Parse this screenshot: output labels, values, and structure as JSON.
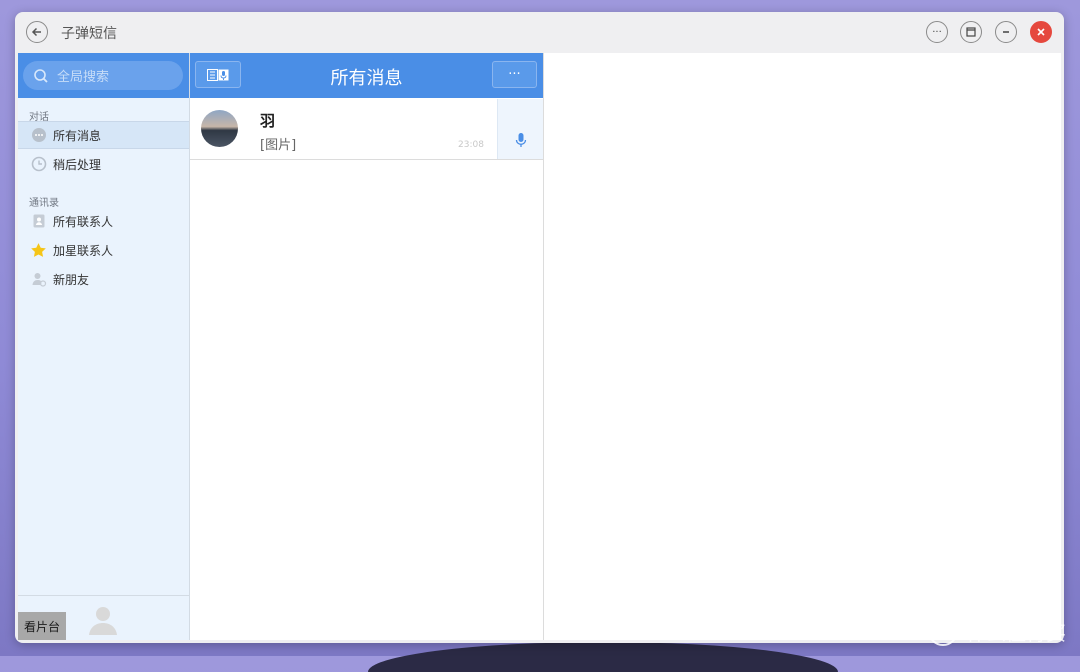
{
  "window": {
    "title": "子弹短信"
  },
  "sidebar": {
    "search_placeholder": "全局搜索",
    "sections": [
      {
        "label": "对话",
        "items": [
          {
            "label": "所有消息",
            "icon": "chat-bubble-icon",
            "active": true
          },
          {
            "label": "稍后处理",
            "icon": "clock-icon",
            "active": false
          }
        ]
      },
      {
        "label": "通讯录",
        "items": [
          {
            "label": "所有联系人",
            "icon": "address-book-icon",
            "active": false
          },
          {
            "label": "加星联系人",
            "icon": "star-icon",
            "active": false
          },
          {
            "label": "新朋友",
            "icon": "add-user-icon",
            "active": false
          }
        ]
      }
    ],
    "footer_label": "看片台"
  },
  "list": {
    "title": "所有消息",
    "more_label": "···",
    "conversations": [
      {
        "name": "羽",
        "preview": "[图片]",
        "time": "23:08"
      }
    ]
  },
  "watermark": {
    "text": "什么值得买",
    "icon": "値"
  },
  "colors": {
    "accent": "#4a8ee6",
    "sidebar_bg": "#eaf3fd",
    "close": "#e5483e"
  }
}
